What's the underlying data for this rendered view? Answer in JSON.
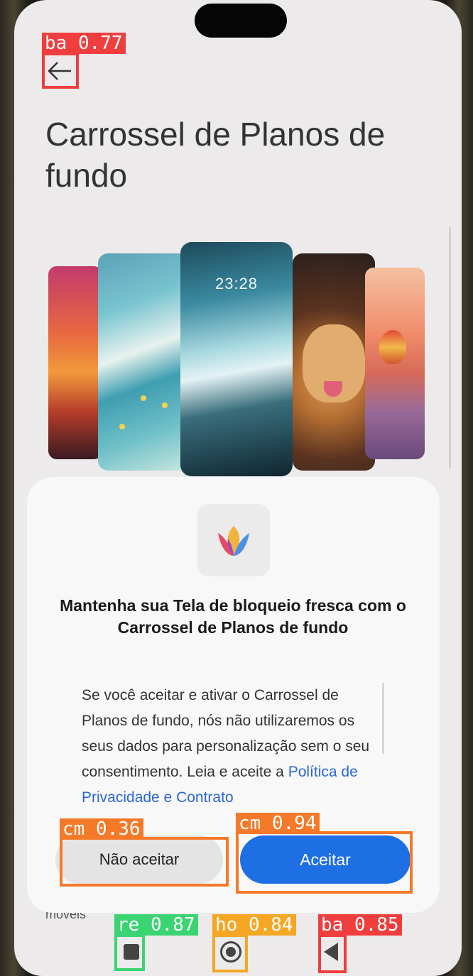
{
  "screen": {
    "title": "Carrossel de Planos de fundo",
    "preview_clock": "23:28"
  },
  "dialog": {
    "title": "Mantenha sua Tela de bloqueio fresca com o Carrossel de Planos de fundo",
    "body": "Se você aceitar e ativar o Carrossel de Planos de fundo, nós não utilizaremos os seus dados para personalização sem o seu consentimento. Leia e aceite a ",
    "link": "Política de Privacidade e Contrato",
    "decline_label": "Não aceitar",
    "accept_label": "Aceitar"
  },
  "under_text": "móveis",
  "detections": {
    "back_top": "ba 0.77",
    "decline": "cm 0.36",
    "accept": "cm 0.94",
    "recent": "re 0.87",
    "home": "ho 0.84",
    "back_nav": "ba 0.85"
  },
  "colors": {
    "accent": "#1e6fe3",
    "back_box": "#f03e3e",
    "button_box": "#f47a2a",
    "recent_box": "#3ad472",
    "home_box": "#f5a623"
  },
  "icons": [
    "back-arrow-icon",
    "tulip-icon",
    "recent-apps-icon",
    "home-icon",
    "back-triangle-icon"
  ]
}
